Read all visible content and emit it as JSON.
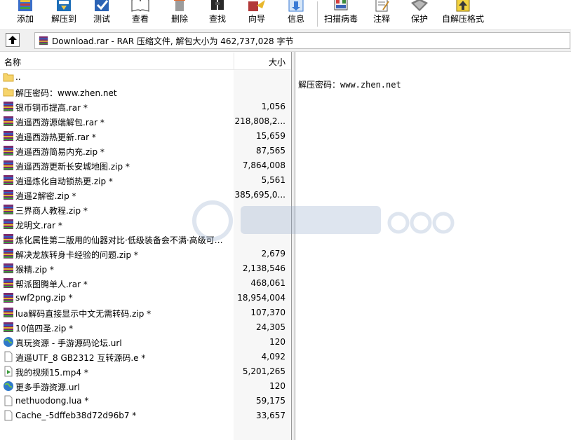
{
  "toolbar": {
    "buttons": [
      {
        "label": "添加",
        "icon": "add-icon"
      },
      {
        "label": "解压到",
        "icon": "extract-to-icon"
      },
      {
        "label": "测试",
        "icon": "test-icon"
      },
      {
        "label": "查看",
        "icon": "view-icon"
      },
      {
        "label": "删除",
        "icon": "delete-icon"
      },
      {
        "label": "查找",
        "icon": "find-icon"
      },
      {
        "label": "向导",
        "icon": "wizard-icon"
      },
      {
        "label": "信息",
        "icon": "info-icon"
      },
      {
        "label": "扫描病毒",
        "icon": "virus-scan-icon"
      },
      {
        "label": "注释",
        "icon": "comment-icon"
      },
      {
        "label": "保护",
        "icon": "protect-icon"
      },
      {
        "label": "自解压格式",
        "icon": "sfx-icon"
      }
    ]
  },
  "address": {
    "path": "Download.rar - RAR 压缩文件, 解包大小为 462,737,028 字节"
  },
  "columns": {
    "name": "名称",
    "size": "大小"
  },
  "files": [
    {
      "name": "..",
      "size": "",
      "type": "folder"
    },
    {
      "name": "解压密码：www.zhen.net",
      "size": "",
      "type": "folder"
    },
    {
      "name": "银币铜币提高.rar *",
      "size": "1,056",
      "type": "rar"
    },
    {
      "name": "逍遥西游源端解包.rar *",
      "size": "218,808,2...",
      "type": "rar"
    },
    {
      "name": "逍遥西游热更新.rar *",
      "size": "15,659",
      "type": "rar"
    },
    {
      "name": "逍遥西游简易内充.zip *",
      "size": "87,565",
      "type": "rar"
    },
    {
      "name": "逍遥西游更新长安城地图.zip *",
      "size": "7,864,008",
      "type": "rar"
    },
    {
      "name": "逍遥炼化自动锁热更.zip *",
      "size": "5,561",
      "type": "rar"
    },
    {
      "name": "逍遥2解密.zip *",
      "size": "385,695,0...",
      "type": "rar"
    },
    {
      "name": "三界商人教程.zip *",
      "size": "",
      "type": "rar"
    },
    {
      "name": "龙明文.rar *",
      "size": "",
      "type": "rar"
    },
    {
      "name": "炼化属性第二版用的仙器对比·低级装备会不满·高级可能...",
      "size": "",
      "type": "rar"
    },
    {
      "name": "解决龙族转身卡经验的问题.zip *",
      "size": "2,679",
      "type": "rar"
    },
    {
      "name": "猴精.zip *",
      "size": "2,138,546",
      "type": "rar"
    },
    {
      "name": "帮派图腾单人.rar *",
      "size": "468,061",
      "type": "rar"
    },
    {
      "name": "swf2png.zip *",
      "size": "18,954,004",
      "type": "rar"
    },
    {
      "name": "lua解码直接显示中文无需转码.zip *",
      "size": "107,370",
      "type": "rar"
    },
    {
      "name": "10倍四圣.zip *",
      "size": "24,305",
      "type": "rar"
    },
    {
      "name": "真玩资源 - 手游源码论坛.url",
      "size": "120",
      "type": "url"
    },
    {
      "name": "逍遥UTF_8 GB2312 互转源码.e *",
      "size": "4,092",
      "type": "doc"
    },
    {
      "name": "我的视频15.mp4 *",
      "size": "5,201,265",
      "type": "video"
    },
    {
      "name": "更多手游资源.url",
      "size": "120",
      "type": "url"
    },
    {
      "name": "nethuodong.lua *",
      "size": "59,175",
      "type": "doc"
    },
    {
      "name": "Cache_-5dffeb38d72d96b7 *",
      "size": "33,657",
      "type": "doc"
    }
  ],
  "comment": {
    "text": "解压密码：www.zhen.net"
  }
}
